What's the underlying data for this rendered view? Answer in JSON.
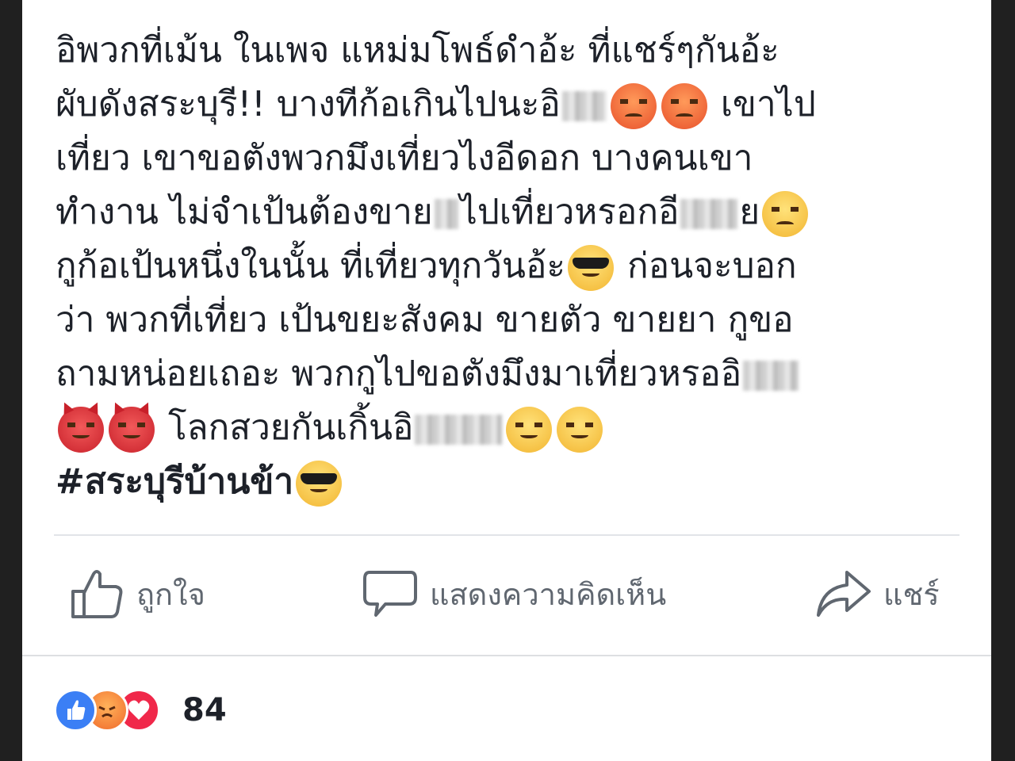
{
  "post": {
    "lines": [
      [
        "อิพวกที่เม้น ในเพจ แหม่มโพธ์ดำอ้ะ ที่แชร์ๆกันอ้ะ"
      ],
      [
        "ผับดังสระบุรี!!  บางทีก้อเกินไปนะอิ",
        " เขาไป"
      ],
      [
        "เที่ยว เขาขอตังพวกมึงเที่ยวไงอีดอก  บางคนเขา"
      ],
      [
        "ทำงาน ไม่จำเป้นต้องขาย",
        "ไปเที่ยวหรอกอี",
        "ย"
      ],
      [
        "กูก้อเป้นหนึ่งในนั้น ที่เที่ยวทุกวันอ้ะ",
        "  ก่อนจะบอก"
      ],
      [
        "ว่า พวกที่เที่ยว เป้นขยะสังคม ขายตัว ขายยา  กูขอ"
      ],
      [
        "ถามหน่อยเถอะ พวกกูไปขอตังมึงมาเที่ยวหรออิ"
      ],
      [
        "  โลกสวยกันเกิ้นอิ"
      ],
      [
        "#สระบุรีบ้านข้า"
      ]
    ]
  },
  "actions": {
    "like_label": "ถูกใจ",
    "comment_label": "แสดงความคิดเห็น",
    "share_label": "แชร์"
  },
  "icons": {
    "like": "thumbs-up-icon",
    "comment": "speech-bubble-icon",
    "share": "share-arrow-icon"
  },
  "reactions": {
    "count": "84",
    "types": [
      "like",
      "angry",
      "love"
    ]
  },
  "colors": {
    "text": "#1d2129",
    "muted": "#606770",
    "like_blue": "#3b7ff5",
    "love_red": "#f0284a"
  }
}
